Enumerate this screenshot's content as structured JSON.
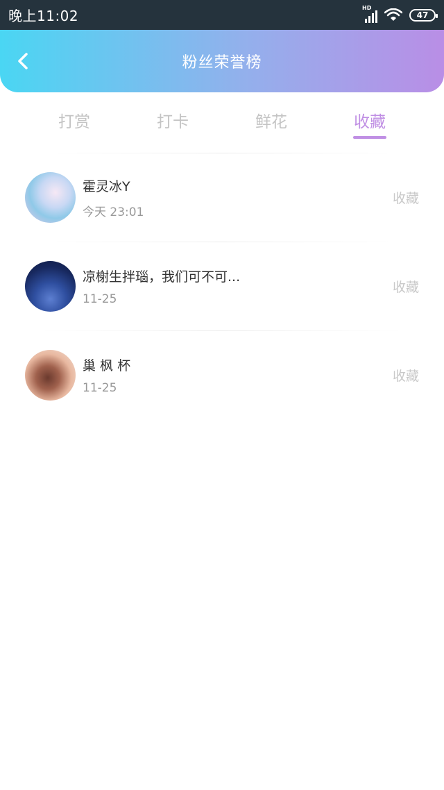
{
  "status_bar": {
    "time": "晚上11:02",
    "network_label": "HD",
    "battery": "47",
    "icons": [
      "signal-icon",
      "wifi-icon",
      "battery-icon"
    ]
  },
  "header": {
    "title": "粉丝荣誉榜",
    "back_icon": "chevron-left-icon",
    "gradient_start": "#4ad6f3",
    "gradient_end": "#b98ee6"
  },
  "tabs": [
    {
      "label": "打赏",
      "active": false
    },
    {
      "label": "打卡",
      "active": false
    },
    {
      "label": "鲜花",
      "active": false
    },
    {
      "label": "收藏",
      "active": true
    }
  ],
  "accent_color": "#c08fe4",
  "fans": [
    {
      "name": "霍灵冰Y",
      "date": "今天 23:01",
      "action": "收藏",
      "avatar": "anime-girl-blue-hair-avatar"
    },
    {
      "name": "凉榭生拌瑙，我们可不可...",
      "date": "11-25",
      "action": "收藏",
      "avatar": "night-sky-avatar"
    },
    {
      "name": "巢 枫 杯",
      "date": "11-25",
      "action": "收藏",
      "avatar": "anime-boy-avatar"
    }
  ]
}
